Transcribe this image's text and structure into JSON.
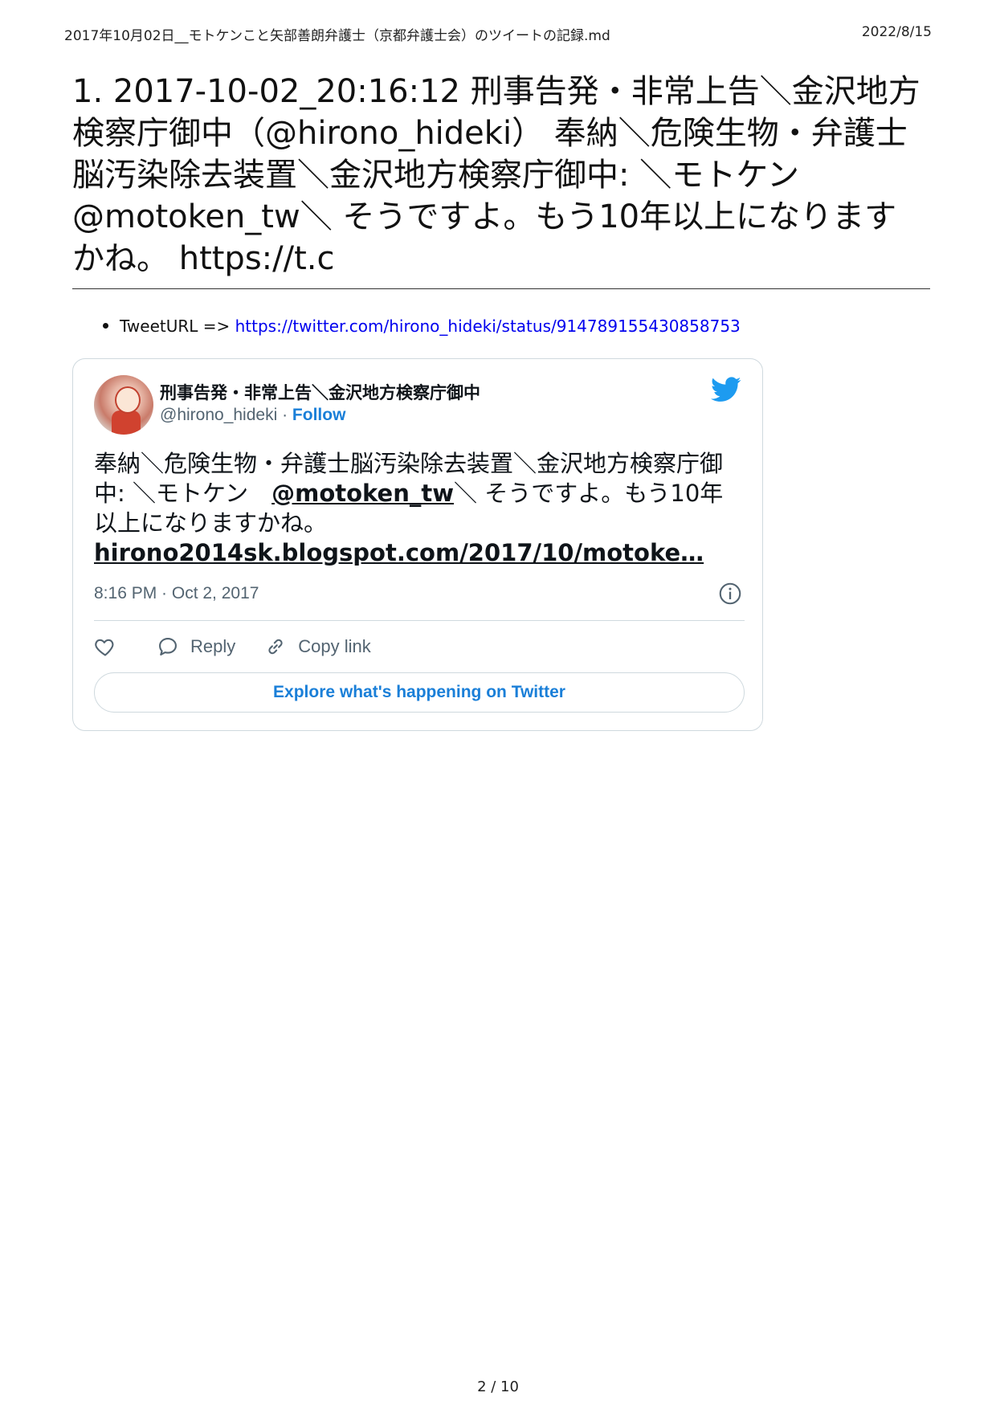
{
  "header": {
    "doc_title": "2017年10月02日__モトケンこと矢部善朗弁護士（京都弁護士会）のツイートの記録.md",
    "date": "2022/8/15"
  },
  "title": "1. 2017-10-02_20:16:12 刑事告発・非常上告＼金沢地方検察庁御中（@hirono_hideki） 奉納＼危険生物・弁護士脳汚染除去装置＼金沢地方検察庁御中: ＼モトケン @motoken_tw＼ そうですよ。もう10年以上になりますかね。 https://t.c",
  "tweet_url": {
    "label": "TweetURL =>",
    "url": "https://twitter.com/hirono_hideki/status/914789155430858753"
  },
  "tweet": {
    "author_name": "刑事告発・非常上告＼金沢地方検察庁御中",
    "handle": "@hirono_hideki",
    "separator": " · ",
    "follow_label": "Follow",
    "text_before": "奉納＼危険生物・弁護士脳汚染除去装置＼金沢地方検察庁御中: ＼モトケン　",
    "mention": "@motoken_tw",
    "text_after": "＼ そうですよ。もう10年以上になりますかね。",
    "link": "hirono2014sk.blogspot.com/2017/10/motoke…",
    "timestamp": "8:16 PM · Oct 2, 2017",
    "reply_label": "Reply",
    "copy_link_label": "Copy link",
    "explore_label": "Explore what's happening on Twitter",
    "accent_color": "#1d9bf0"
  },
  "footer": {
    "page_number": "2 / 10"
  },
  "icons": [
    "twitter-bird-icon",
    "info-icon",
    "heart-icon",
    "reply-bubble-icon",
    "link-icon"
  ]
}
